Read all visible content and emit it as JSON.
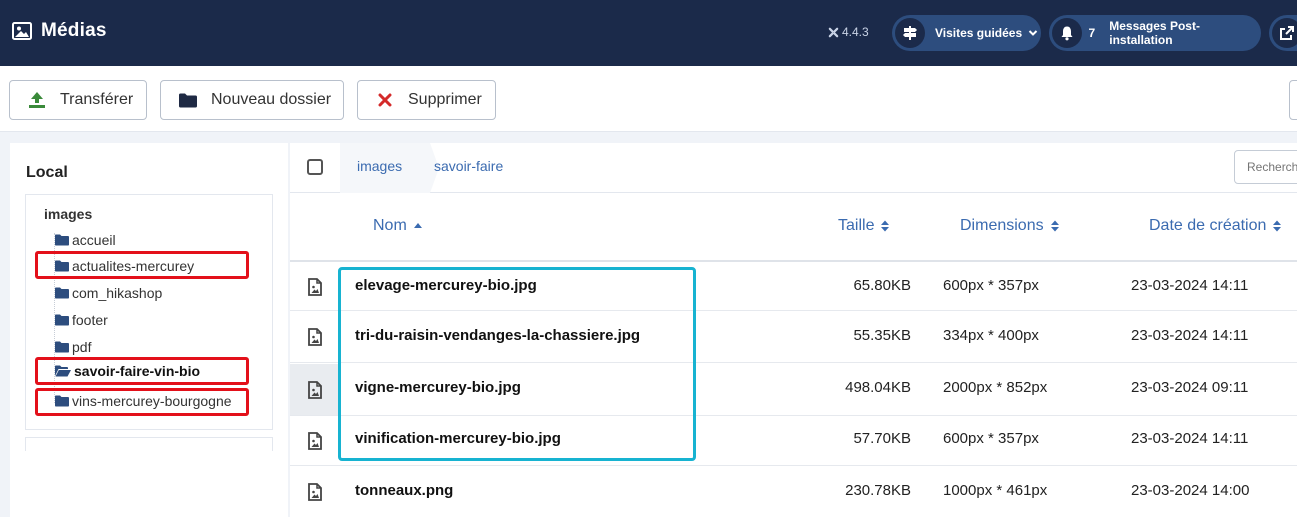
{
  "header": {
    "title": "Médias",
    "version": "4.4.3",
    "guided_tours_label": "Visites guidées",
    "messages_count": "7",
    "messages_label": "Messages Post-installation"
  },
  "toolbar": {
    "upload_label": "Transférer",
    "new_folder_label": "Nouveau dossier",
    "delete_label": "Supprimer"
  },
  "sidebar": {
    "section_title": "Local",
    "root": "images",
    "items": [
      {
        "label": "accueil"
      },
      {
        "label": "actualites-mercurey"
      },
      {
        "label": "com_hikashop"
      },
      {
        "label": "footer"
      },
      {
        "label": "pdf"
      },
      {
        "label": "savoir-faire-vin-bio"
      },
      {
        "label": "vins-mercurey-bourgogne"
      }
    ]
  },
  "breadcrumb": [
    "images",
    "savoir-faire"
  ],
  "search": {
    "placeholder": "Rechercher"
  },
  "table": {
    "columns": {
      "name": "Nom",
      "size": "Taille",
      "dimensions": "Dimensions",
      "date": "Date de création"
    },
    "rows": [
      {
        "name": "elevage-mercurey-bio.jpg",
        "size": "65.80KB",
        "dimensions": "600px * 357px",
        "date": "23-03-2024 14:11"
      },
      {
        "name": "tri-du-raisin-vendanges-la-chassiere.jpg",
        "size": "55.35KB",
        "dimensions": "334px * 400px",
        "date": "23-03-2024 14:11"
      },
      {
        "name": "vigne-mercurey-bio.jpg",
        "size": "498.04KB",
        "dimensions": "2000px * 852px",
        "date": "23-03-2024 09:11"
      },
      {
        "name": "vinification-mercurey-bio.jpg",
        "size": "57.70KB",
        "dimensions": "600px * 357px",
        "date": "23-03-2024 14:11"
      },
      {
        "name": "tonneaux.png",
        "size": "230.78KB",
        "dimensions": "1000px * 461px",
        "date": "23-03-2024 14:00"
      }
    ]
  },
  "colors": {
    "header_bg": "#1b2a4a",
    "link_blue": "#3b6bb0",
    "annotation_red": "#e3101a",
    "annotation_cyan": "#17b3d1"
  }
}
